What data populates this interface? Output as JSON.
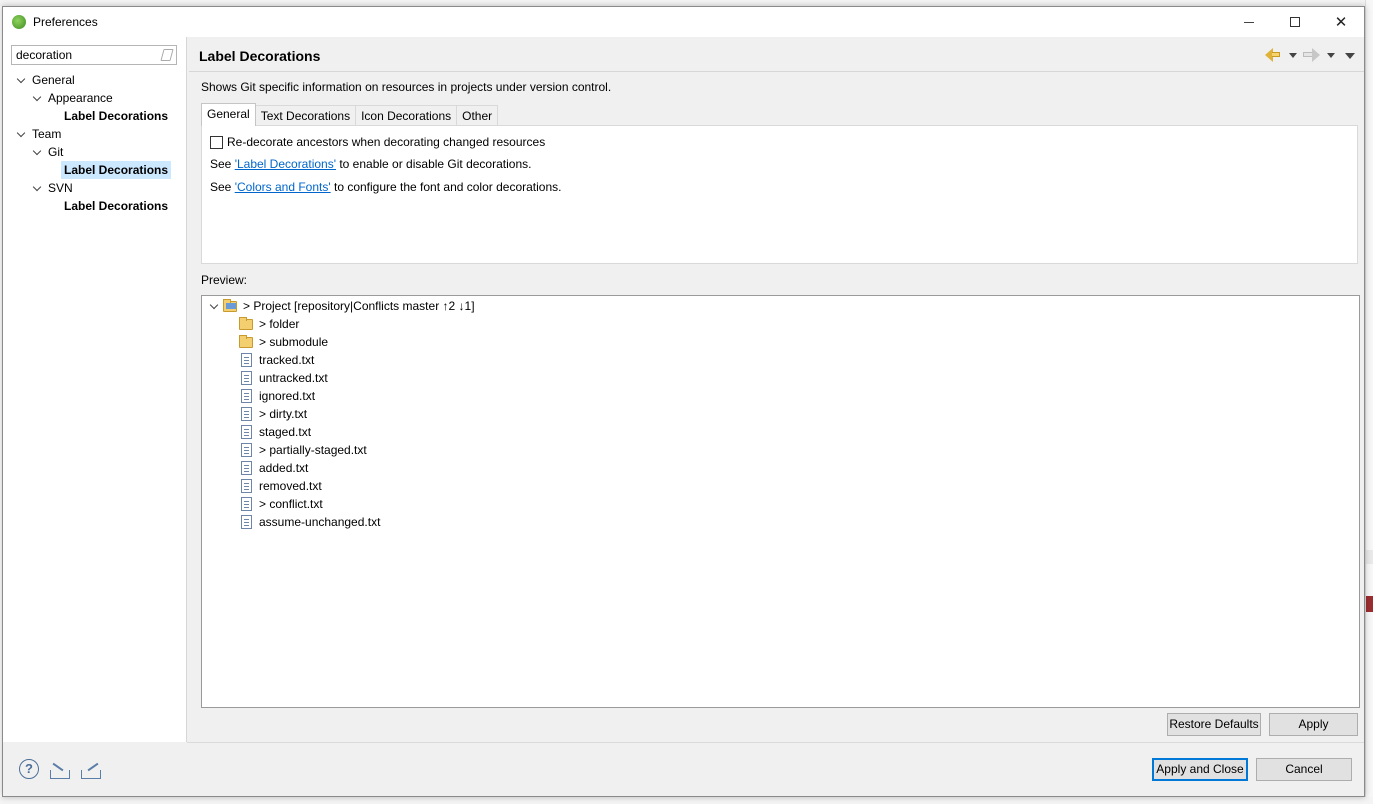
{
  "window": {
    "title": "Preferences",
    "minimize_label": "",
    "maximize_label": "",
    "close_label": "✕"
  },
  "filter": {
    "value": "decoration"
  },
  "nav_tree": {
    "general": "General",
    "appearance": "Appearance",
    "appearance_label_decorations": "Label Decorations",
    "team": "Team",
    "git": "Git",
    "git_label_decorations": "Label Decorations",
    "svn": "SVN",
    "svn_label_decorations": "Label Decorations"
  },
  "page": {
    "title": "Label Decorations",
    "description": "Shows Git specific information on resources in projects under version control."
  },
  "tabs": [
    "General",
    "Text Decorations",
    "Icon Decorations",
    "Other"
  ],
  "general_tab": {
    "checkbox_label": "Re-decorate ancestors when decorating changed resources",
    "checkbox_checked": false,
    "line1_prefix": "See ",
    "line1_link": "'Label Decorations'",
    "line1_suffix": " to enable or disable Git decorations.",
    "line2_prefix": "See ",
    "line2_link": "'Colors and Fonts'",
    "line2_suffix": " to configure the font and color decorations."
  },
  "preview": {
    "label": "Preview:",
    "project": "> Project [repository|Conflicts master ↑2 ↓1]",
    "items": [
      {
        "text": "> folder",
        "icon": "folder"
      },
      {
        "text": "> submodule",
        "icon": "folder"
      },
      {
        "text": "tracked.txt",
        "icon": "file"
      },
      {
        "text": "untracked.txt",
        "icon": "file"
      },
      {
        "text": "ignored.txt",
        "icon": "file"
      },
      {
        "text": "> dirty.txt",
        "icon": "file"
      },
      {
        "text": "staged.txt",
        "icon": "file"
      },
      {
        "text": "> partially-staged.txt",
        "icon": "file"
      },
      {
        "text": "added.txt",
        "icon": "file"
      },
      {
        "text": "removed.txt",
        "icon": "file"
      },
      {
        "text": "> conflict.txt",
        "icon": "file"
      },
      {
        "text": "assume-unchanged.txt",
        "icon": "file"
      }
    ]
  },
  "buttons": {
    "restore_defaults": "Restore Defaults",
    "apply": "Apply",
    "apply_and_close": "Apply and Close",
    "cancel": "Cancel"
  },
  "bottom_icons": {
    "help": "?"
  }
}
